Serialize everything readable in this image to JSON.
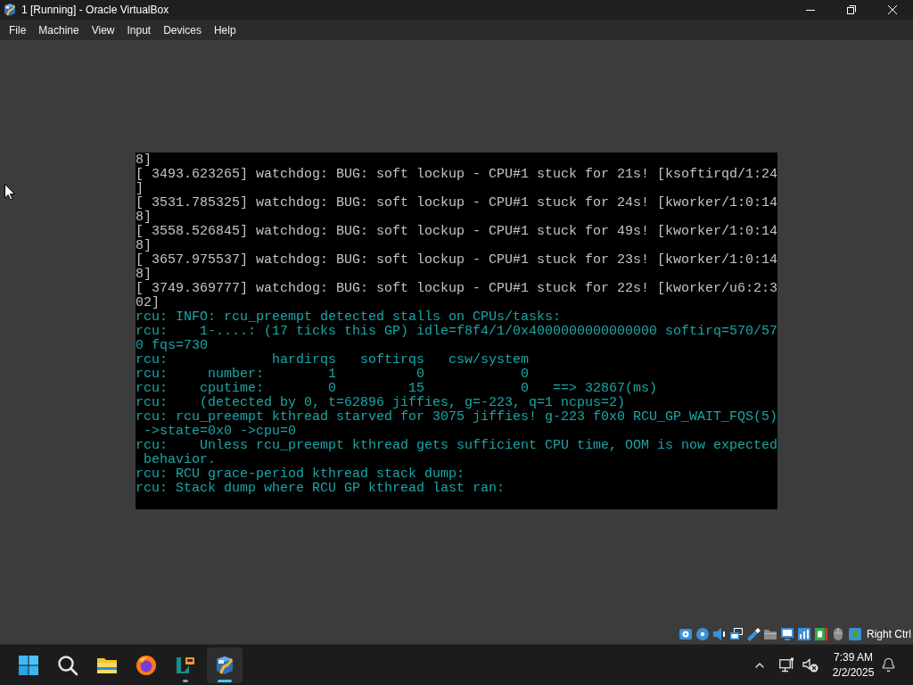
{
  "window": {
    "title": "1 [Running] - Oracle VirtualBox",
    "controls": [
      {
        "kind": "minimize"
      },
      {
        "kind": "restore"
      },
      {
        "kind": "close"
      }
    ]
  },
  "menu": [
    "File",
    "Machine",
    "View",
    "Input",
    "Devices",
    "Help"
  ],
  "console": {
    "lines": [
      {
        "text": "8]",
        "kind": "watchdog"
      },
      {
        "text": "[ 3493.623265] watchdog: BUG: soft lockup - CPU#1 stuck for 21s! [ksoftirqd/1:24",
        "kind": "watchdog"
      },
      {
        "text": "]",
        "kind": "watchdog"
      },
      {
        "text": "[ 3531.785325] watchdog: BUG: soft lockup - CPU#1 stuck for 24s! [kworker/1:0:14",
        "kind": "watchdog"
      },
      {
        "text": "8]",
        "kind": "watchdog"
      },
      {
        "text": "[ 3558.526845] watchdog: BUG: soft lockup - CPU#1 stuck for 49s! [kworker/1:0:14",
        "kind": "watchdog"
      },
      {
        "text": "8]",
        "kind": "watchdog"
      },
      {
        "text": "[ 3657.975537] watchdog: BUG: soft lockup - CPU#1 stuck for 23s! [kworker/1:0:14",
        "kind": "watchdog"
      },
      {
        "text": "8]",
        "kind": "watchdog"
      },
      {
        "text": "[ 3749.369777] watchdog: BUG: soft lockup - CPU#1 stuck for 22s! [kworker/u6:2:3",
        "kind": "watchdog"
      },
      {
        "text": "02]",
        "kind": "watchdog"
      },
      {
        "text": "rcu: INFO: rcu_preempt detected stalls on CPUs/tasks:",
        "kind": "rcu"
      },
      {
        "text": "rcu:    1-....: (17 ticks this GP) idle=f8f4/1/0x4000000000000000 softirq=570/57",
        "kind": "rcu"
      },
      {
        "text": "0 fqs=730",
        "kind": "rcu"
      },
      {
        "text": "rcu:             hardirqs   softirqs   csw/system",
        "kind": "rcu"
      },
      {
        "text": "rcu:     number:        1          0            0",
        "kind": "rcu"
      },
      {
        "text": "rcu:    cputime:        0         15            0   ==> 32867(ms)",
        "kind": "rcu"
      },
      {
        "text": "rcu:    (detected by 0, t=62896 jiffies, g=-223, q=1 ncpus=2)",
        "kind": "rcu"
      },
      {
        "text": "rcu: rcu_preempt kthread starved for 3075 jiffies! g-223 f0x0 RCU_GP_WAIT_FQS(5)",
        "kind": "rcu"
      },
      {
        "text": " ->state=0x0 ->cpu=0",
        "kind": "rcu"
      },
      {
        "text": "rcu:    Unless rcu_preempt kthread gets sufficient CPU time, OOM is now expected",
        "kind": "rcu"
      },
      {
        "text": " behavior.",
        "kind": "rcu"
      },
      {
        "text": "rcu: RCU grace-period kthread stack dump:",
        "kind": "rcu"
      },
      {
        "text": "rcu: Stack dump where RCU GP kthread last ran:",
        "kind": "rcu"
      }
    ]
  },
  "status_bar": {
    "indicators": [
      {
        "kind": "hard_disk",
        "active": true
      },
      {
        "kind": "optical",
        "active": true
      },
      {
        "kind": "audio",
        "active": true
      },
      {
        "kind": "network",
        "active": true
      },
      {
        "kind": "usb",
        "active": true
      },
      {
        "kind": "shared_folders",
        "active": false
      },
      {
        "kind": "display",
        "active": true
      },
      {
        "kind": "recording",
        "active": true
      },
      {
        "kind": "engine",
        "active": true
      },
      {
        "kind": "mouse",
        "active": false
      },
      {
        "kind": "keyboard",
        "active": true
      }
    ],
    "host_key": "Right Ctrl"
  },
  "taskbar": {
    "items": [
      {
        "kind": "start"
      },
      {
        "kind": "search"
      },
      {
        "kind": "files",
        "selected": false,
        "running": false
      },
      {
        "kind": "browser",
        "selected": false,
        "running": false
      },
      {
        "kind": "editor",
        "selected": false,
        "running": true
      },
      {
        "kind": "virtualbox",
        "selected": true,
        "running": true
      }
    ],
    "tray": {
      "time": "7:39 AM",
      "date": "2/2/2025"
    }
  }
}
